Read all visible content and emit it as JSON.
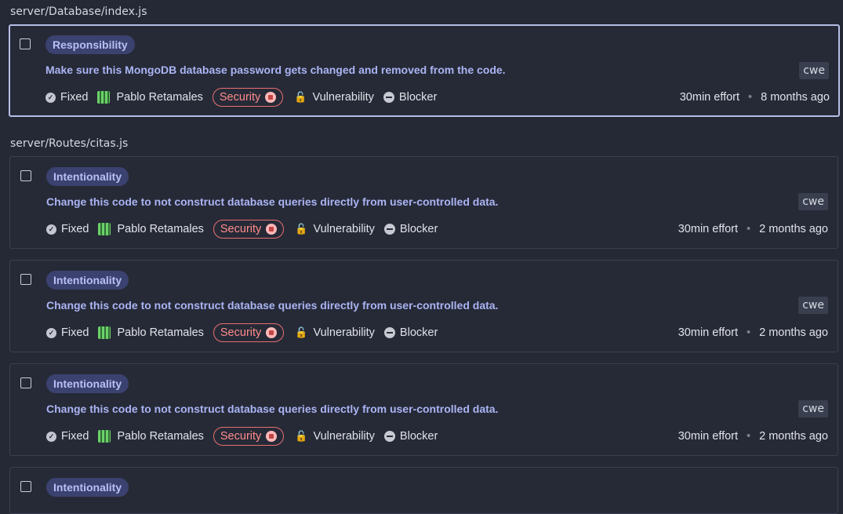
{
  "groups": [
    {
      "path": "server/Database/index.js",
      "issues": [
        {
          "attribute": "Responsibility",
          "message": "Make sure this MongoDB database password gets changed and removed from the code.",
          "tag": "cwe",
          "status": "Fixed",
          "assignee": "Pablo Retamales",
          "quality": "Security",
          "type": "Vulnerability",
          "severity": "Blocker",
          "effort": "30min effort",
          "age": "8 months ago"
        }
      ]
    },
    {
      "path": "server/Routes/citas.js",
      "issues": [
        {
          "attribute": "Intentionality",
          "message": "Change this code to not construct database queries directly from user-controlled data.",
          "tag": "cwe",
          "status": "Fixed",
          "assignee": "Pablo Retamales",
          "quality": "Security",
          "type": "Vulnerability",
          "severity": "Blocker",
          "effort": "30min effort",
          "age": "2 months ago"
        },
        {
          "attribute": "Intentionality",
          "message": "Change this code to not construct database queries directly from user-controlled data.",
          "tag": "cwe",
          "status": "Fixed",
          "assignee": "Pablo Retamales",
          "quality": "Security",
          "type": "Vulnerability",
          "severity": "Blocker",
          "effort": "30min effort",
          "age": "2 months ago"
        },
        {
          "attribute": "Intentionality",
          "message": "Change this code to not construct database queries directly from user-controlled data.",
          "tag": "cwe",
          "status": "Fixed",
          "assignee": "Pablo Retamales",
          "quality": "Security",
          "type": "Vulnerability",
          "severity": "Blocker",
          "effort": "30min effort",
          "age": "2 months ago"
        },
        {
          "attribute": "Intentionality"
        }
      ]
    }
  ],
  "colors": {
    "background": "#252936",
    "accent_text": "#aab4f3",
    "pill_bg": "#3b4270",
    "security": "#ff8c8c",
    "selected_border": "#b6bde6"
  }
}
